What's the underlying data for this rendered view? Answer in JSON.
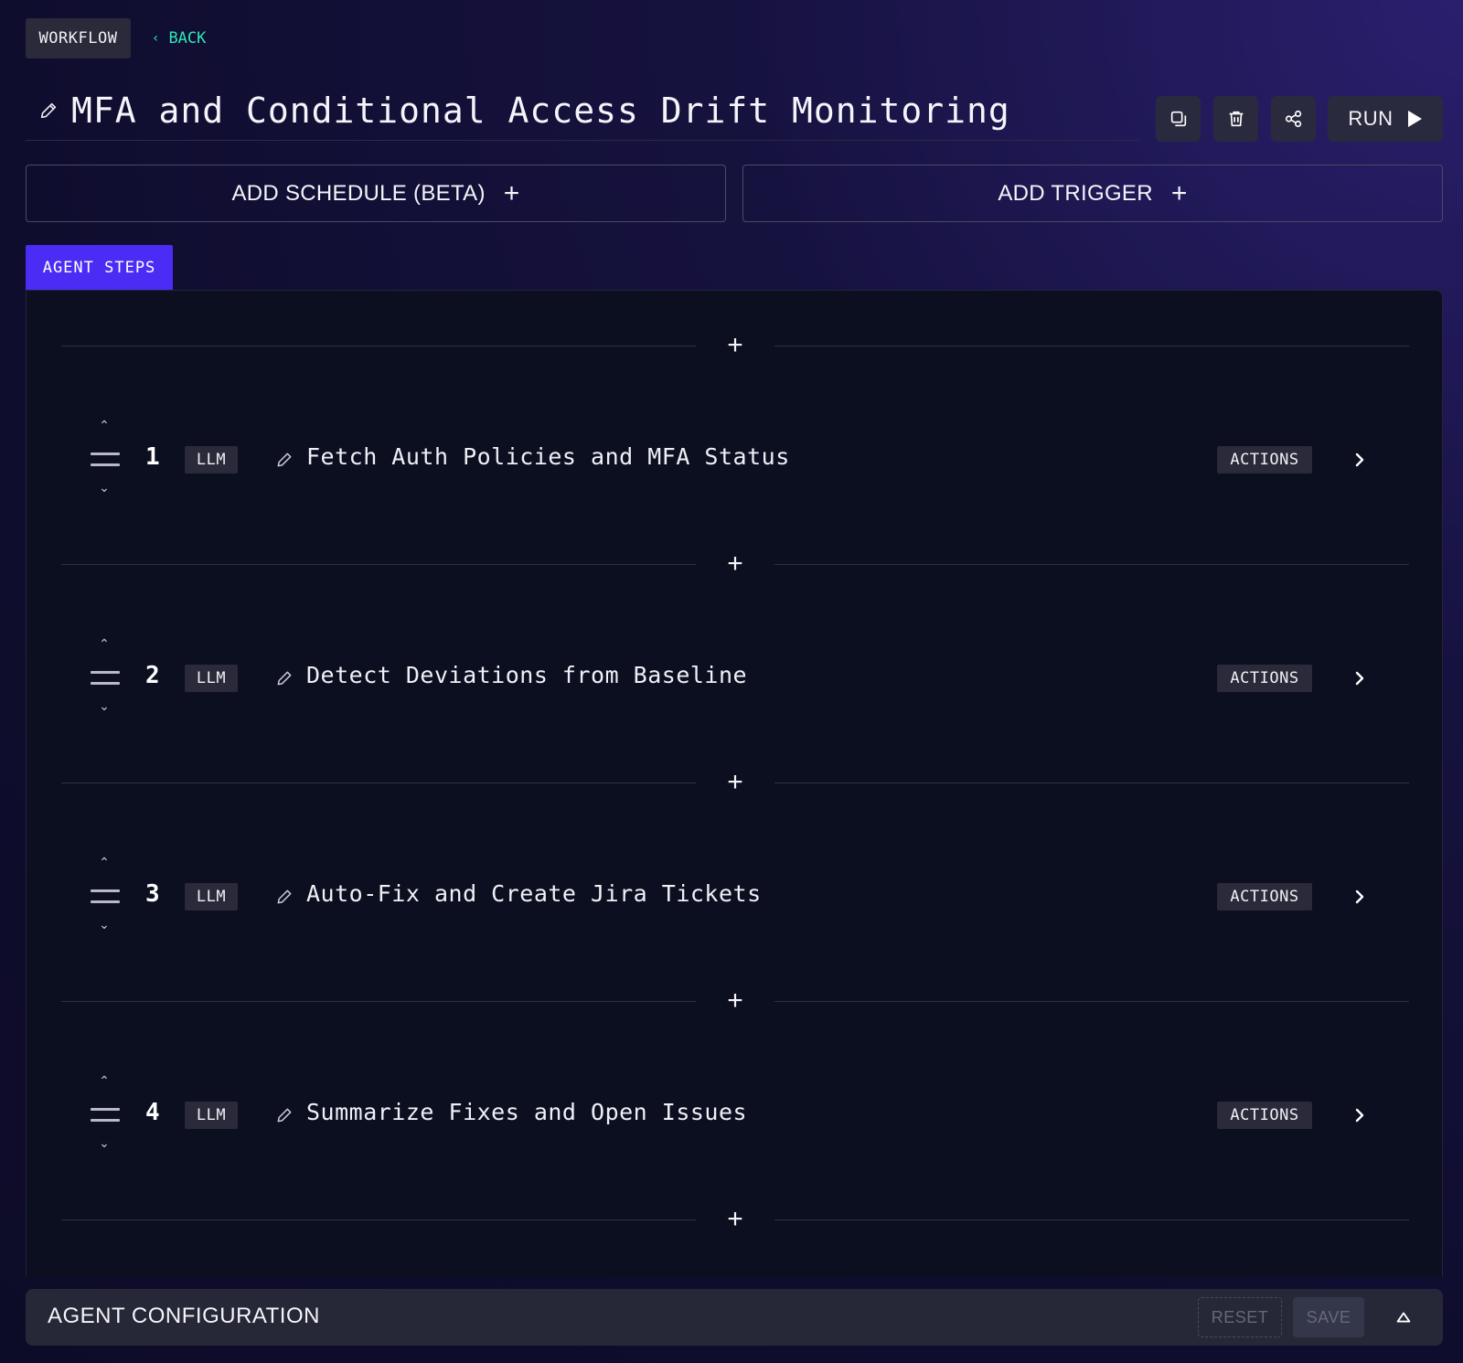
{
  "header": {
    "breadcrumb": "WORKFLOW",
    "back_label": "BACK",
    "title": "MFA and Conditional Access Drift Monitoring",
    "run_label": "RUN"
  },
  "toolbar": {
    "copy_icon": "duplicate-icon",
    "delete_icon": "trash-icon",
    "share_icon": "share-icon",
    "run_icon": "play-icon"
  },
  "schedule": {
    "add_schedule_label": "ADD SCHEDULE (BETA)",
    "add_trigger_label": "ADD TRIGGER"
  },
  "tabs": [
    {
      "label": "AGENT STEPS",
      "active": true
    }
  ],
  "steps": [
    {
      "number": "1",
      "type": "LLM",
      "name": "Fetch Auth Policies and MFA Status",
      "actions_label": "ACTIONS"
    },
    {
      "number": "2",
      "type": "LLM",
      "name": "Detect Deviations from Baseline",
      "actions_label": "ACTIONS"
    },
    {
      "number": "3",
      "type": "LLM",
      "name": "Auto-Fix and Create Jira Tickets",
      "actions_label": "ACTIONS"
    },
    {
      "number": "4",
      "type": "LLM",
      "name": "Summarize Fixes and Open Issues",
      "actions_label": "ACTIONS"
    }
  ],
  "config": {
    "label": "AGENT CONFIGURATION",
    "reset_label": "RESET",
    "save_label": "SAVE"
  },
  "colors": {
    "accent": "#4b2cf5",
    "back_link": "#2ee6b8",
    "panel_bg": "#0c0f1f"
  }
}
